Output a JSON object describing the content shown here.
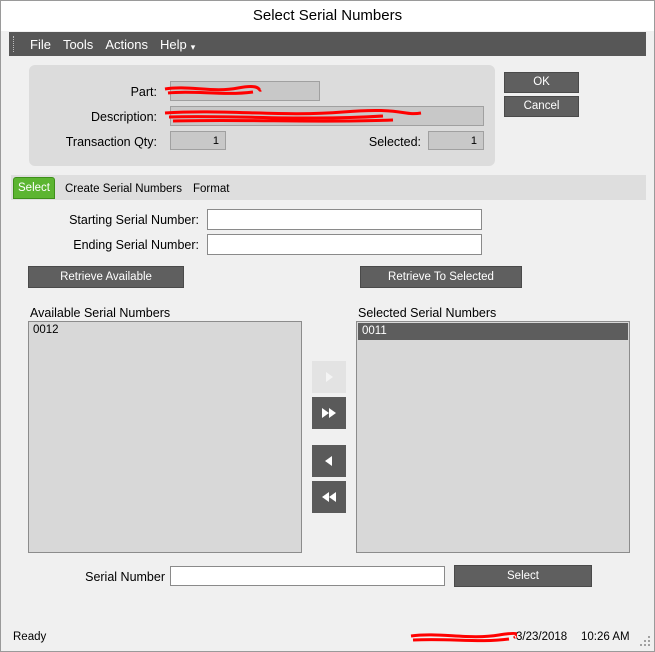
{
  "window": {
    "title": "Select Serial Numbers"
  },
  "menu": {
    "items": [
      "File",
      "Tools",
      "Actions",
      "Help"
    ]
  },
  "header": {
    "part_label": "Part:",
    "description_label": "Description:",
    "transaction_qty_label": "Transaction Qty:",
    "transaction_qty_value": "1",
    "selected_label": "Selected:",
    "selected_value": "1"
  },
  "dialog_buttons": {
    "ok": "OK",
    "cancel": "Cancel"
  },
  "tabs": [
    "Select",
    "Create Serial Numbers",
    "Format"
  ],
  "range": {
    "starting_label": "Starting Serial Number:",
    "starting_value": "",
    "ending_label": "Ending Serial Number:",
    "ending_value": ""
  },
  "actions": {
    "retrieve_available": "Retrieve Available",
    "retrieve_to_selected": "Retrieve To Selected"
  },
  "available": {
    "label": "Available Serial Numbers",
    "items": [
      "0012"
    ]
  },
  "selected": {
    "label": "Selected Serial Numbers",
    "items": [
      "0011"
    ]
  },
  "serial_entry": {
    "label": "Serial Number",
    "value": "",
    "select_button": "Select"
  },
  "status": {
    "text": "Ready",
    "date": "3/23/2018",
    "time": "10:26 AM"
  },
  "colors": {
    "accent_tab": "#5cb531",
    "button_dark": "#5f5f5f",
    "redaction": "#ff0000"
  }
}
